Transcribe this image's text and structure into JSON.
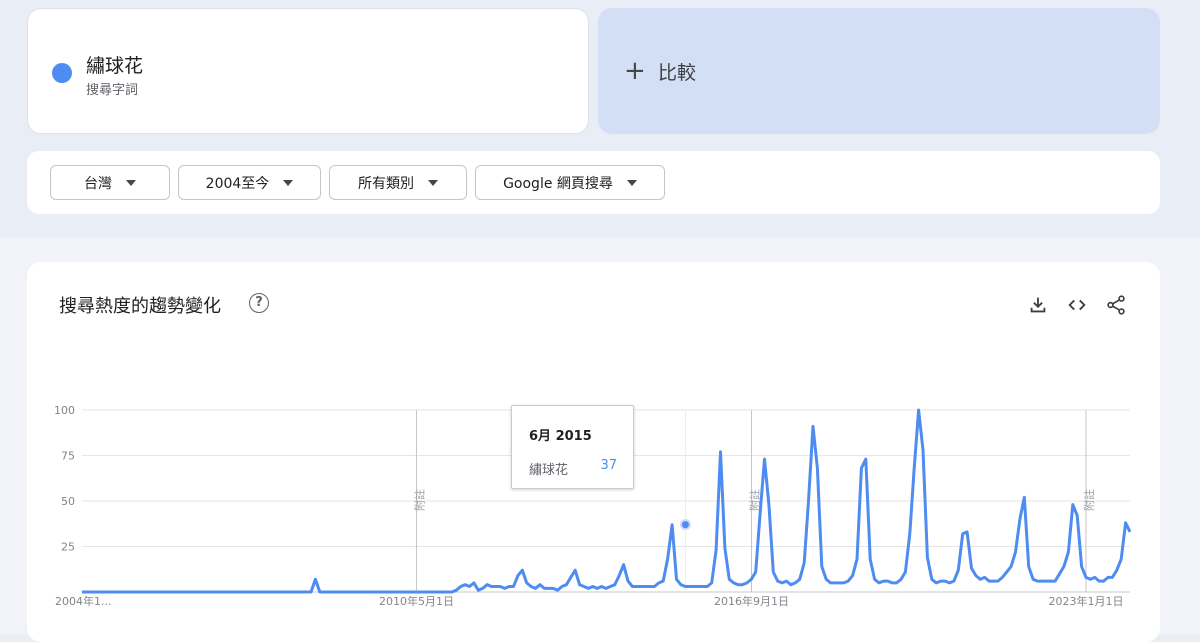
{
  "search_term": {
    "name": "繡球花",
    "subtitle": "搜尋字詞",
    "color": "#4e8cf1"
  },
  "compare": {
    "plus": "+",
    "label": "比較"
  },
  "filters": [
    {
      "label": "台灣"
    },
    {
      "label": "2004至今"
    },
    {
      "label": "所有類別"
    },
    {
      "label": "Google 網頁搜尋"
    }
  ],
  "chart_panel": {
    "title": "搜尋熱度的趨勢變化",
    "help_glyph": "?",
    "icons": [
      "download-icon",
      "embed-code-icon",
      "share-icon"
    ]
  },
  "tooltip": {
    "date": "6月 2015",
    "term": "繡球花",
    "value": "37"
  },
  "chart_data": {
    "type": "line",
    "title": "",
    "xlabel": "",
    "ylabel": "",
    "ylim": [
      0,
      100
    ],
    "yticks": [
      25,
      50,
      75,
      100
    ],
    "grid": true,
    "line_color": "#4e8cf1",
    "start_year": 2004,
    "x_tick_labels": [
      {
        "label": "2004年1...",
        "year": 2004.0
      },
      {
        "label": "2010年5月1日",
        "year": 2010.33
      },
      {
        "label": "2016年9月1日",
        "year": 2016.67
      },
      {
        "label": "2023年1月1日",
        "year": 2023.0
      }
    ],
    "annotation_marks": [
      {
        "label": "附註",
        "year": 2010.33
      },
      {
        "label": "附註",
        "year": 2016.67
      },
      {
        "label": "附註",
        "year": 2023.0
      }
    ],
    "hover": {
      "year": 2015.42,
      "value": 37
    },
    "series": [
      {
        "name": "繡球花",
        "values": [
          0,
          0,
          0,
          0,
          0,
          0,
          0,
          0,
          0,
          0,
          0,
          0,
          0,
          0,
          0,
          0,
          0,
          0,
          0,
          0,
          0,
          0,
          0,
          0,
          0,
          0,
          0,
          0,
          0,
          0,
          0,
          0,
          0,
          0,
          0,
          0,
          0,
          0,
          0,
          0,
          0,
          0,
          0,
          0,
          0,
          0,
          0,
          0,
          0,
          0,
          0,
          0,
          0,
          7,
          0,
          0,
          0,
          0,
          0,
          0,
          0,
          0,
          0,
          0,
          0,
          0,
          0,
          0,
          0,
          0,
          0,
          0,
          0,
          0,
          0,
          0,
          0,
          0,
          0,
          0,
          0,
          0,
          0,
          0,
          0,
          1,
          3,
          4,
          3,
          5,
          1,
          2,
          4,
          3,
          3,
          3,
          2,
          3,
          3,
          9,
          12,
          5,
          3,
          2,
          4,
          2,
          2,
          2,
          1,
          3,
          4,
          8,
          12,
          4,
          3,
          2,
          3,
          2,
          3,
          2,
          3,
          4,
          9,
          15,
          6,
          3,
          3,
          3,
          3,
          3,
          3,
          5,
          6,
          18,
          37,
          7,
          4,
          3,
          3,
          3,
          3,
          3,
          3,
          5,
          23,
          77,
          24,
          7,
          5,
          4,
          4,
          5,
          7,
          11,
          43,
          73,
          48,
          11,
          6,
          5,
          6,
          4,
          5,
          7,
          16,
          51,
          91,
          68,
          14,
          7,
          5,
          5,
          5,
          5,
          6,
          9,
          18,
          68,
          73,
          18,
          7,
          5,
          6,
          6,
          5,
          5,
          7,
          11,
          32,
          68,
          100,
          78,
          19,
          7,
          5,
          6,
          6,
          5,
          6,
          12,
          32,
          33,
          13,
          9,
          7,
          8,
          6,
          6,
          6,
          8,
          11,
          14,
          22,
          40,
          52,
          14,
          7,
          6,
          6,
          6,
          6,
          6,
          10,
          14,
          22,
          48,
          42,
          14,
          8,
          7,
          8,
          6,
          6,
          8,
          8,
          12,
          18,
          38,
          33
        ]
      }
    ]
  }
}
